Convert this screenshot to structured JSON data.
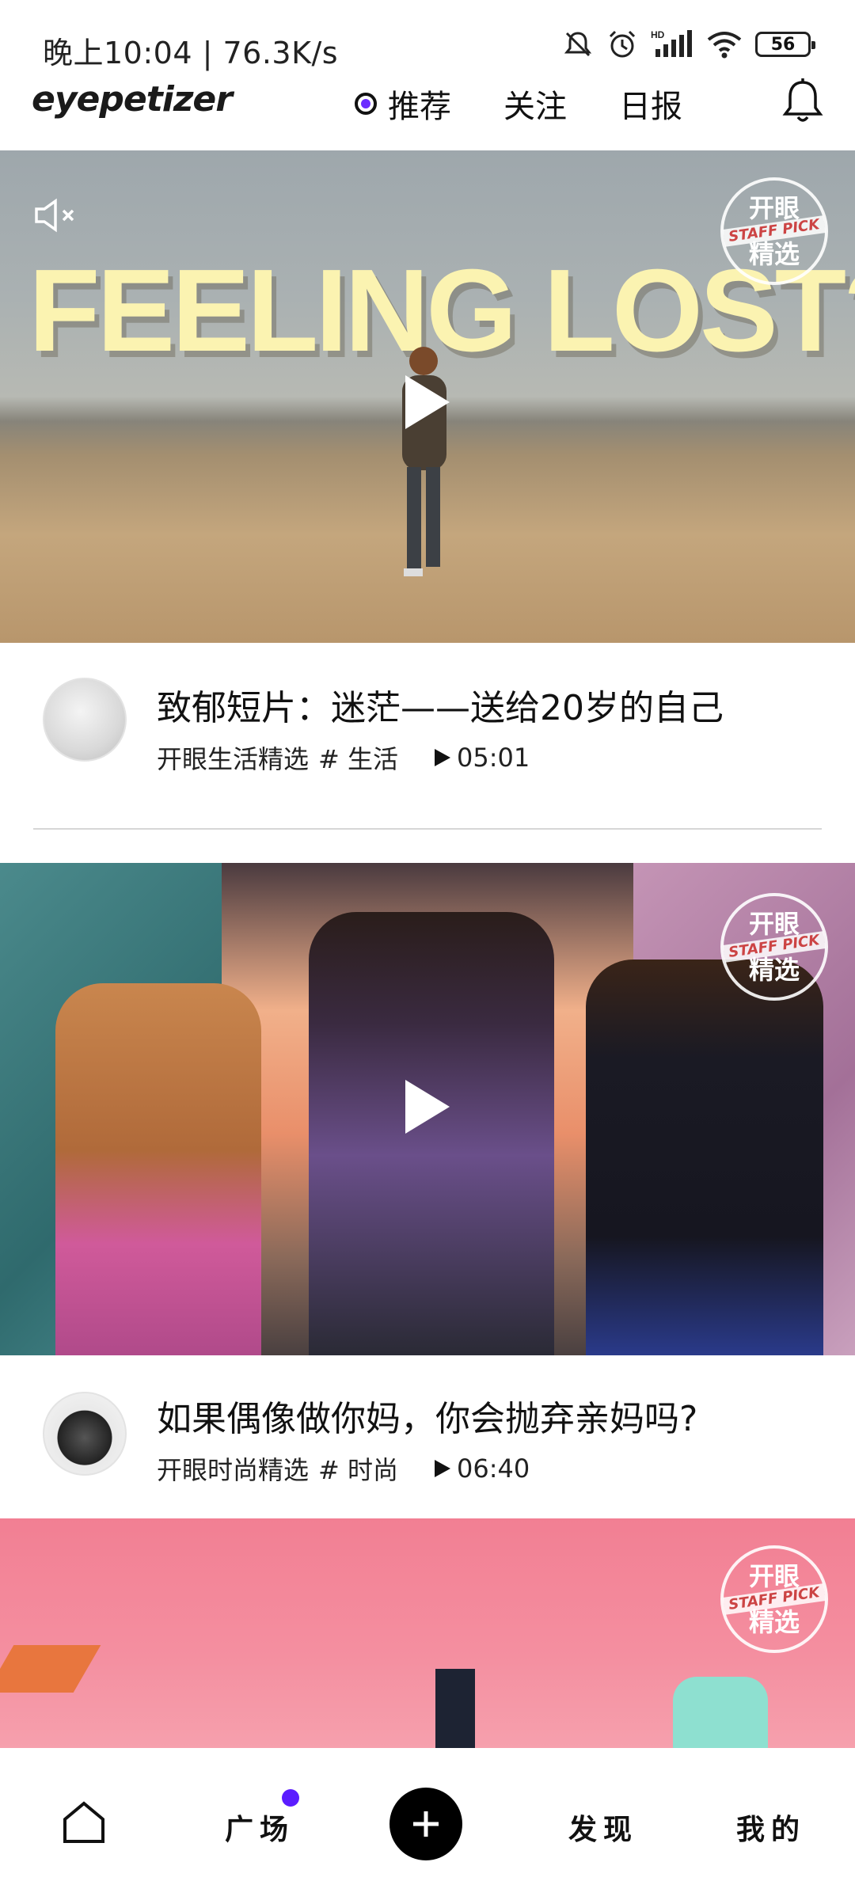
{
  "status_bar": {
    "time_speed": "晚上10:04 | 76.3K/s",
    "battery": "56",
    "icons": [
      "mute-bell-icon",
      "alarm-icon",
      "hd-signal-icon",
      "wifi-icon",
      "battery-icon"
    ]
  },
  "header": {
    "logo": "eyepetizer",
    "tabs": [
      {
        "label": "推荐",
        "active": true
      },
      {
        "label": "关注",
        "active": false
      },
      {
        "label": "日报",
        "active": false
      }
    ],
    "notification_icon": "bell-icon"
  },
  "feed": [
    {
      "overlay_title": "FEELING LOST?",
      "badge": {
        "line1": "开眼",
        "line2": "STAFF PICK",
        "line3": "精选"
      },
      "title": "致郁短片：迷茫——送给20岁的自己",
      "channel": "开眼生活精选",
      "tag": "# 生活",
      "duration": "05:01"
    },
    {
      "badge": {
        "line1": "开眼",
        "line2": "STAFF PICK",
        "line3": "精选"
      },
      "title": "如果偶像做你妈，你会抛弃亲妈吗?",
      "channel": "开眼时尚精选",
      "tag": "# 时尚",
      "duration": "06:40"
    },
    {
      "badge": {
        "line1": "开眼",
        "line2": "STAFF PICK",
        "line3": "精选"
      }
    }
  ],
  "bottom_nav": {
    "items": [
      {
        "label": "",
        "icon": "home-icon"
      },
      {
        "label": "广场",
        "badge_dot": true
      },
      {
        "label": "",
        "icon": "plus-icon"
      },
      {
        "label": "发现"
      },
      {
        "label": "我的"
      }
    ],
    "accent": "#5b1cff"
  }
}
